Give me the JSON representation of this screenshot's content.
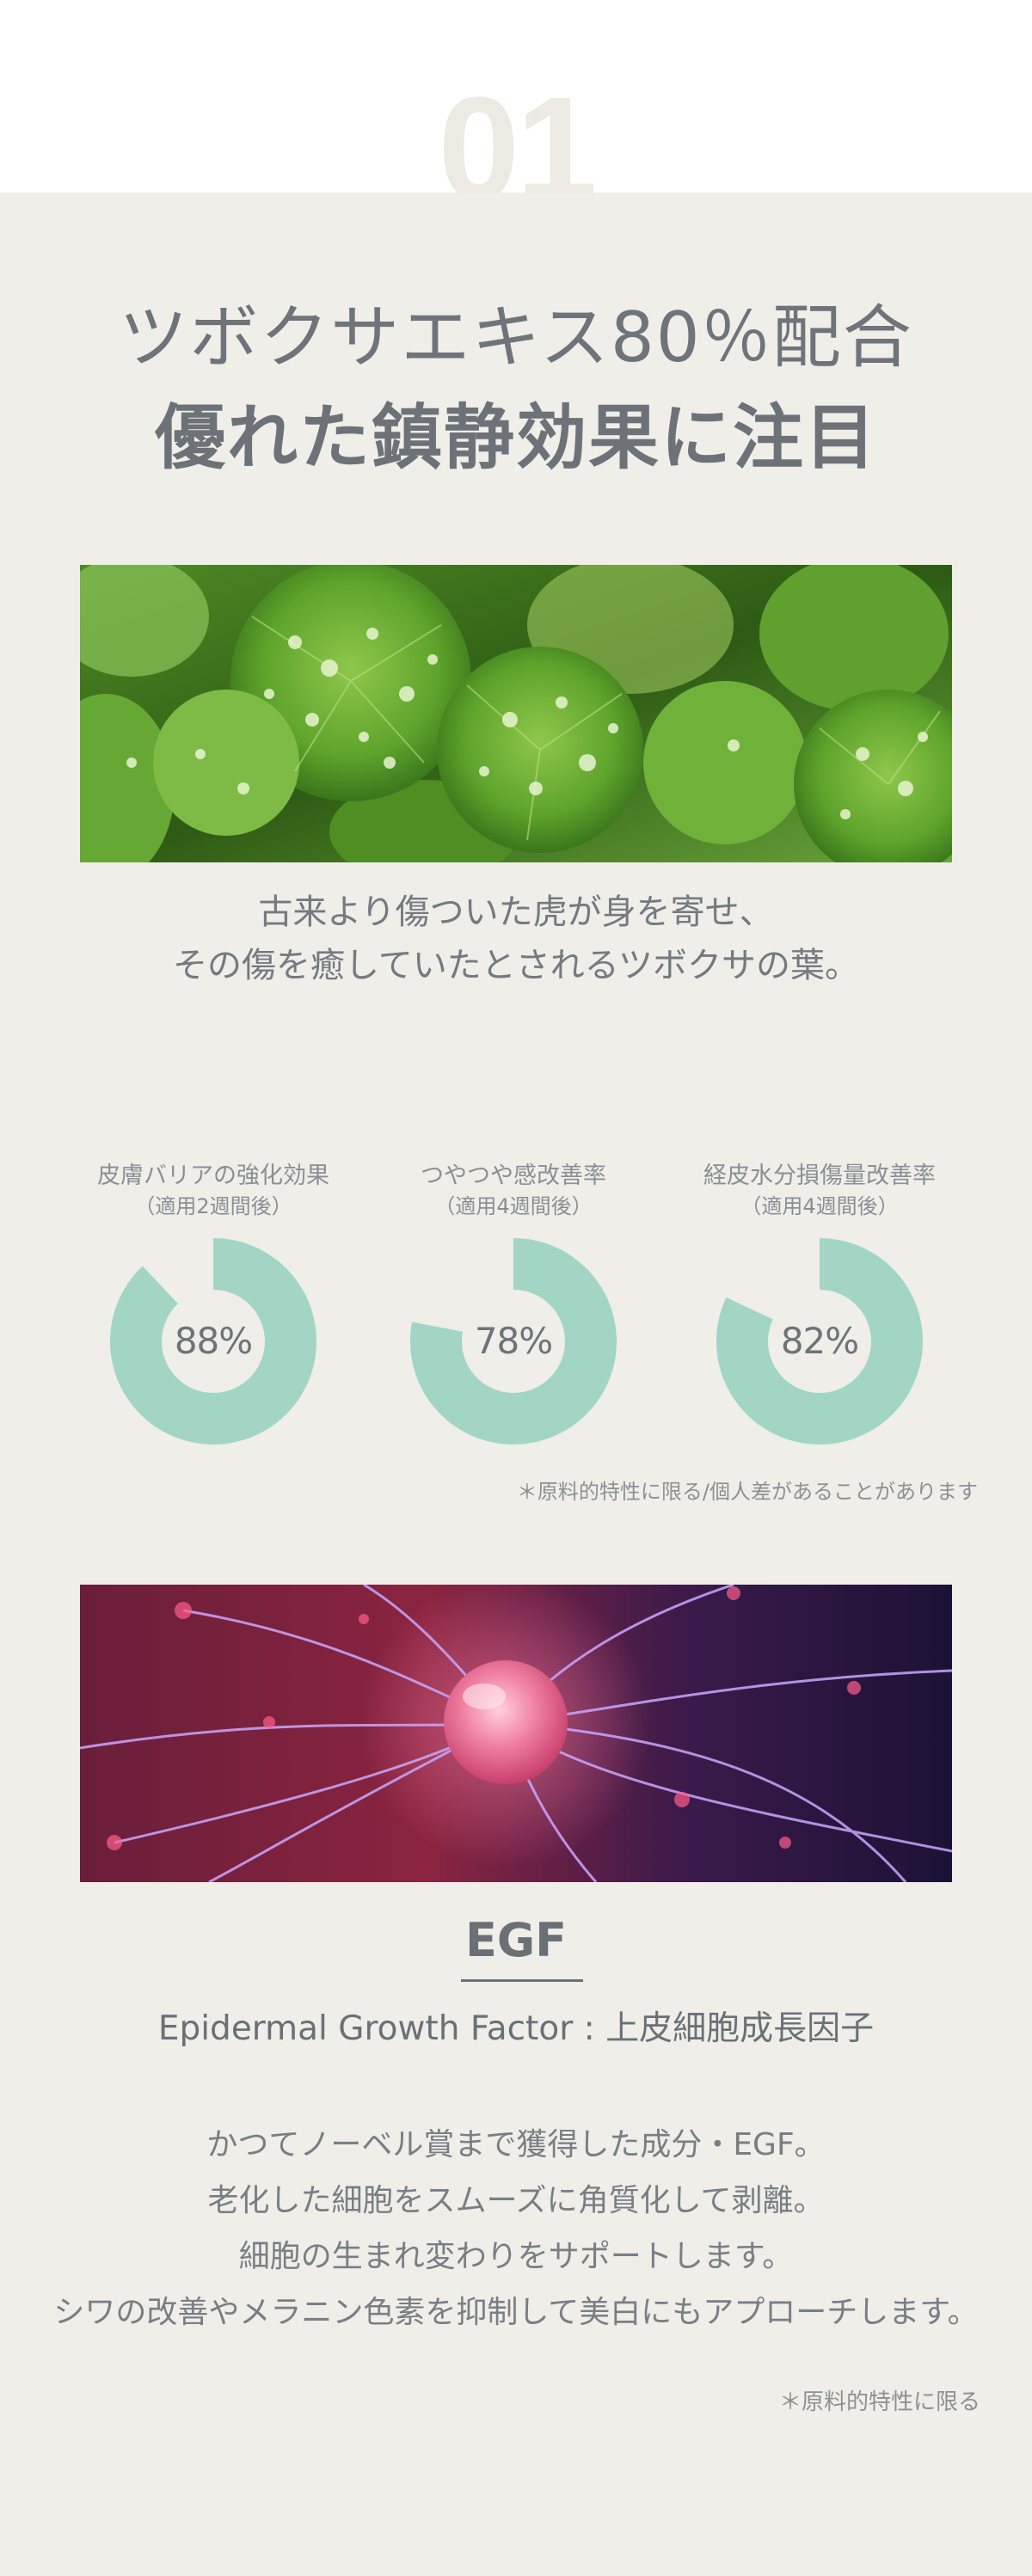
{
  "section_number": "01",
  "headline": {
    "line1": "ツボクサエキス80％配合",
    "line2": "優れた鎮静効果に注目"
  },
  "images": {
    "top_photo": "centella-leaves-photo",
    "bottom_photo": "plasma-ball-photo"
  },
  "caption": {
    "line1": "古来より傷ついた虎が身を寄せ、",
    "line2": "その傷を癒していたとされるツボクサの葉。"
  },
  "stats": [
    {
      "label": "皮膚バリアの強化効果",
      "sub": "（適用2週間後）",
      "value": 88,
      "display": "88%"
    },
    {
      "label": "つやつや感改善率",
      "sub": "（適用4週間後）",
      "value": 78,
      "display": "78%"
    },
    {
      "label": "経皮水分損傷量改善率",
      "sub": "（適用4週間後）",
      "value": 82,
      "display": "82%"
    }
  ],
  "colors": {
    "donut_fill": "#a3d5c4",
    "background": "#efeee8",
    "text": "#6f7379"
  },
  "note_stats": "＊原料的特性に限る/個人差があることがあります",
  "egf": {
    "title": "EGF",
    "subtitle": "Epidermal Growth Factor : 上皮細胞成長因子",
    "body": [
      "かつてノーベル賞まで獲得した成分・EGF。",
      "老化した細胞をスムーズに角質化して剥離。",
      "細胞の生まれ変わりをサポートします。",
      "シワの改善やメラニン色素を抑制して美白にもアプローチします。"
    ],
    "note": "＊原料的特性に限る"
  }
}
